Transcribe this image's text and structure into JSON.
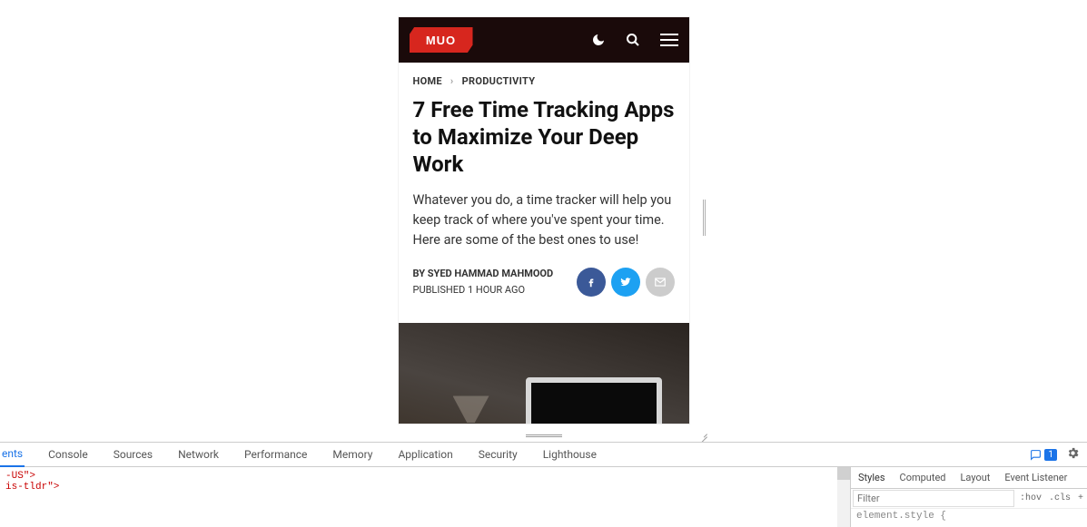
{
  "header": {
    "logo_text": "MUO"
  },
  "breadcrumbs": {
    "home": "HOME",
    "sep": "›",
    "category": "PRODUCTIVITY"
  },
  "article": {
    "title": "7 Free Time Tracking Apps to Maximize Your Deep Work",
    "subtitle": "Whatever you do, a time tracker will help you keep track of where you've spent your time. Here are some of the best ones to use!",
    "by_label": "BY",
    "author": "SYED HAMMAD MAHMOOD",
    "pub_label": "PUBLISHED",
    "pub_time": "1 HOUR AGO"
  },
  "devtools": {
    "tabs": {
      "elements_partial": "ents",
      "console": "Console",
      "sources": "Sources",
      "network": "Network",
      "performance": "Performance",
      "memory": "Memory",
      "application": "Application",
      "security": "Security",
      "lighthouse": "Lighthouse"
    },
    "badge_count": "1",
    "source_lines": {
      "l1": "-US\">",
      "l2": "",
      "l3": "is-tldr\">"
    },
    "right": {
      "subtabs": {
        "styles": "Styles",
        "computed": "Computed",
        "layout": "Layout",
        "event": "Event Listener"
      },
      "filter_placeholder": "Filter",
      "hov": ":hov",
      "cls": ".cls",
      "plus": "+",
      "style_line": "element.style {"
    }
  }
}
